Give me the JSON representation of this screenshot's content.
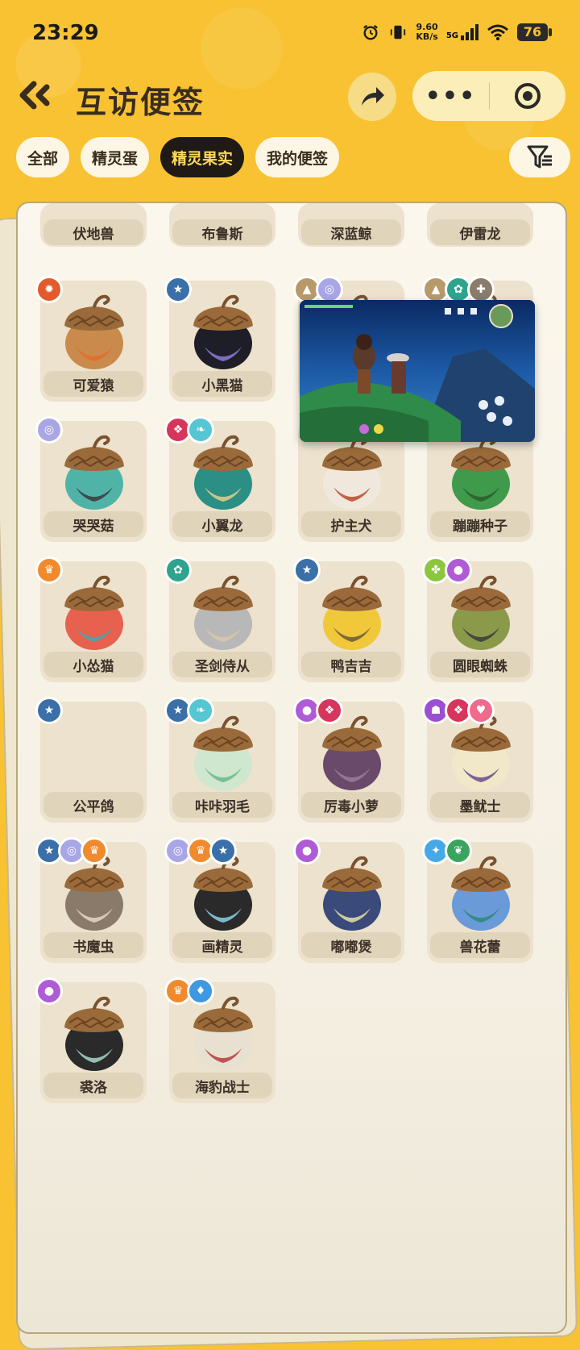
{
  "status": {
    "time": "23:29",
    "net_speed_value": "9.60",
    "net_speed_unit": "KB/s",
    "network": "5G",
    "battery": "76"
  },
  "header": {
    "title": "互访便签"
  },
  "tabs": [
    {
      "label": "全部",
      "active": false
    },
    {
      "label": "精灵蛋",
      "active": false
    },
    {
      "label": "精灵果实",
      "active": true
    },
    {
      "label": "我的便签",
      "active": false
    }
  ],
  "grid": {
    "top_row": [
      "伏地兽",
      "布鲁斯",
      "深蓝鲸",
      "伊雷龙"
    ],
    "items": [
      {
        "name": "可爱猿",
        "badges": [
          "fire"
        ]
      },
      {
        "name": "小黑猫",
        "badges": [
          "star"
        ]
      },
      {
        "name": "",
        "badges": [
          "mountain",
          "swirl"
        ]
      },
      {
        "name": "",
        "badges": [
          "mountain",
          "gear",
          "extra"
        ]
      },
      {
        "name": "哭哭菇",
        "badges": [
          "swirl"
        ]
      },
      {
        "name": "小翼龙",
        "badges": [
          "demon",
          "wing"
        ]
      },
      {
        "name": "护主犬",
        "badges": []
      },
      {
        "name": "蹦蹦种子",
        "badges": []
      },
      {
        "name": "小怂猫",
        "badges": [
          "badge"
        ]
      },
      {
        "name": "圣剑侍从",
        "badges": [
          "gear"
        ]
      },
      {
        "name": "鸭吉吉",
        "badges": [
          "star"
        ]
      },
      {
        "name": "圆眼蜘蛛",
        "badges": [
          "bug",
          "orb"
        ]
      },
      {
        "name": "公平鸽",
        "badges": [
          "star"
        ]
      },
      {
        "name": "咔咔羽毛",
        "badges": [
          "star",
          "wing"
        ]
      },
      {
        "name": "厉毒小萝",
        "badges": [
          "orb",
          "demon"
        ]
      },
      {
        "name": "墨鱿士",
        "badges": [
          "ghost",
          "demon",
          "heart"
        ]
      },
      {
        "name": "书魔虫",
        "badges": [
          "star",
          "swirl",
          "badge"
        ]
      },
      {
        "name": "画精灵",
        "badges": [
          "swirl",
          "badge",
          "star"
        ]
      },
      {
        "name": "嘟嘟煲",
        "badges": [
          "orb"
        ]
      },
      {
        "name": "兽花蕾",
        "badges": [
          "spark",
          "leaf"
        ]
      },
      {
        "name": "裘洛",
        "badges": [
          "orb"
        ]
      },
      {
        "name": "海豹战士",
        "badges": [
          "badge",
          "water"
        ]
      }
    ]
  },
  "colors": {
    "fire": "#e35b2a",
    "star": "#3a6fa8",
    "mountain": "#b89a6a",
    "swirl": "#a9a6e6",
    "gear": "#2fa38e",
    "demon": "#d6365b",
    "wing": "#55c6d2",
    "badge": "#f08a2c",
    "bug": "#8cc63f",
    "orb": "#b05bd6",
    "ghost": "#9b4fd0",
    "heart": "#ef6a8c",
    "spark": "#46a9e6",
    "leaf": "#3aa45e",
    "water": "#3f98e0",
    "extra": "#8a7b6b"
  },
  "acorn_colors": [
    [
      "#c98a4c",
      "#e86a2a"
    ],
    [
      "#1e1e28",
      "#8c7ad8"
    ],
    [
      "#2f6fb8",
      "#c8d2d8"
    ],
    [
      "#d8d4c8",
      "#8bb0c8"
    ],
    [
      "#4fb3a8",
      "#3a3a3a"
    ],
    [
      "#2b8f86",
      "#e4cf8a"
    ],
    [
      "#f0e8dc",
      "#b84a2c"
    ],
    [
      "#3f9a4c",
      "#2a5c2c"
    ],
    [
      "#e8604e",
      "#49a6b0"
    ],
    [
      "#b8b8b8",
      "#d8c8a8"
    ],
    [
      "#f0c83a",
      "#6a5a3a"
    ],
    [
      "#8a9a4a",
      "#3a3a3a"
    ],
    [
      "#d4ead4",
      "#7ac28a"
    ],
    [
      "#cfe6cf",
      "#6ab88a"
    ],
    [
      "#6a4a6a",
      "#a07aa0"
    ],
    [
      "#f0e8c8",
      "#6a4a8a"
    ],
    [
      "#8a7a6a",
      "#e0d8c8"
    ],
    [
      "#2a2a2a",
      "#8ad0e8"
    ],
    [
      "#3a4a7a",
      "#e8e0a8"
    ],
    [
      "#6a9ad8",
      "#2a8a7a"
    ],
    [
      "#2a2a2a",
      "#a8d8c8"
    ],
    [
      "#e8e0d0",
      "#b83a3a"
    ]
  ]
}
